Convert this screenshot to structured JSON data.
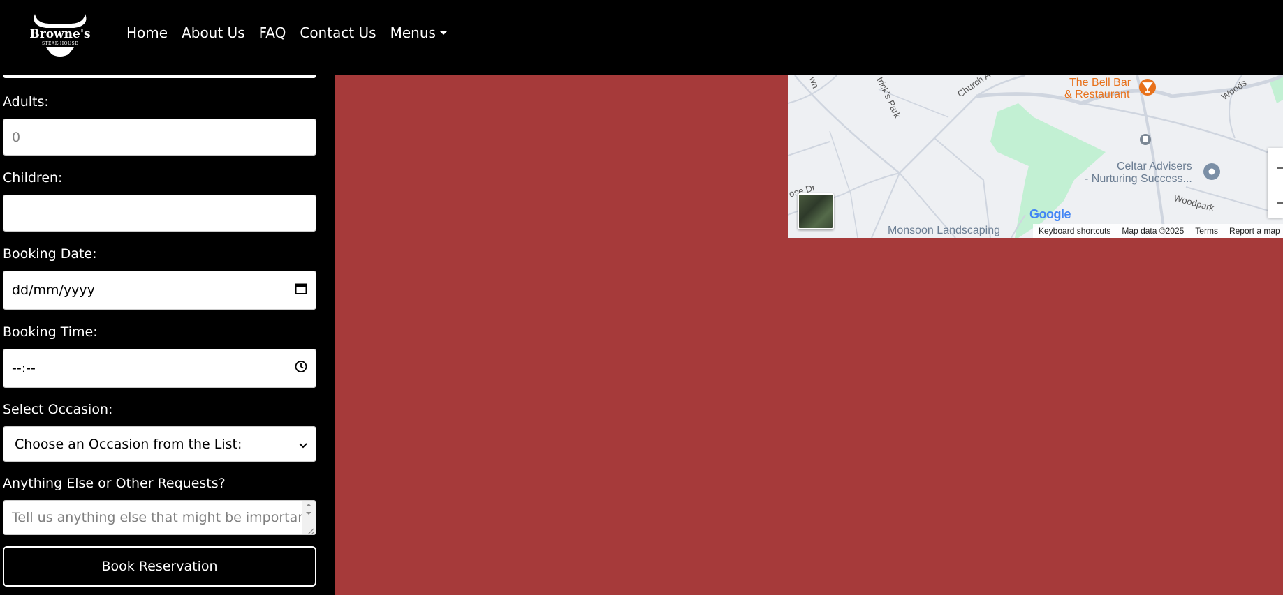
{
  "navbar": {
    "logo_text": "Browne's",
    "logo_subtext": "STEAK-HOUSE",
    "links": [
      "Home",
      "About Us",
      "FAQ",
      "Contact Us",
      "Menus"
    ]
  },
  "form": {
    "adults": {
      "label": "Adults:",
      "placeholder": "0"
    },
    "children": {
      "label": "Children:",
      "value": ""
    },
    "booking_date": {
      "label": "Booking Date:",
      "value": "dd/mm/yyyy"
    },
    "booking_time": {
      "label": "Booking Time:",
      "value": "--:--"
    },
    "occasion": {
      "label": "Select Occasion:",
      "selected": "Choose an Occasion from the List:"
    },
    "requests": {
      "label": "Anything Else or Other Requests?",
      "placeholder": "Tell us anything else that might be important"
    },
    "submit_label": "Book Reservation"
  },
  "map": {
    "labels": {
      "bell_bar_1": "The Bell Bar",
      "bell_bar_2": "& Restaurant",
      "celtar_1": "Celtar Advisers",
      "celtar_2": "- Nurturing Success...",
      "monsoon": "Monsoon Landscaping",
      "church_ave": "Church Ave",
      "patricks_park": "trick's Park",
      "woodpark": "Woodpark",
      "woods": "Woods",
      "road_dr": "ose Dr",
      "road_wn": "wn"
    },
    "google_logo": "Google",
    "footer": {
      "shortcuts": "Keyboard shortcuts",
      "map_data": "Map data ©2025",
      "terms": "Terms",
      "report": "Report a map"
    }
  },
  "colors": {
    "background": "#a63a3a",
    "nav": "#000000",
    "map_park": "#c2f0d3",
    "map_poi_orange": "#e8711a"
  }
}
